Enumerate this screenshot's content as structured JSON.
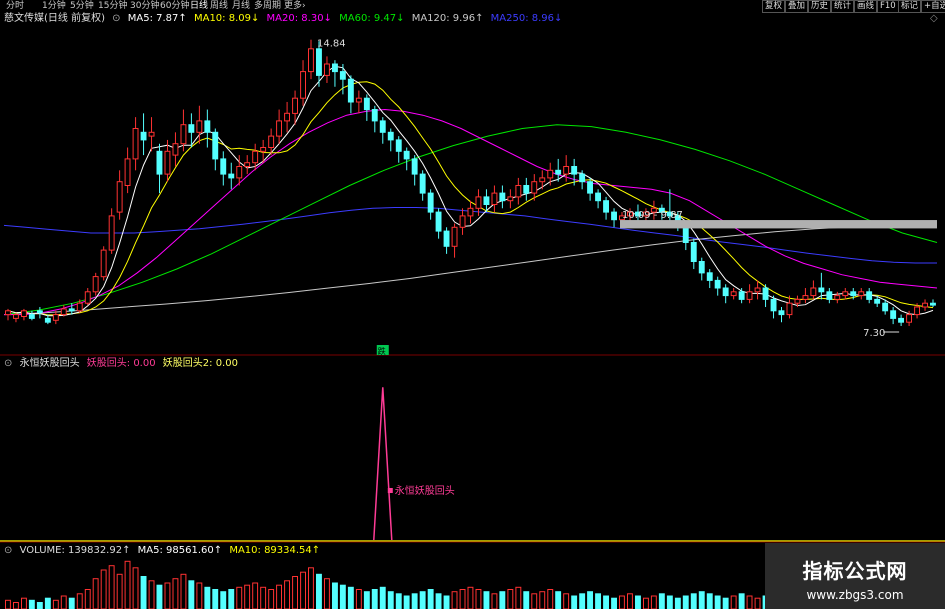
{
  "toolbar": {
    "periods": [
      "分时",
      "1分钟",
      "5分钟",
      "15分钟",
      "30分钟",
      "60分钟",
      "日线",
      "周线",
      "月线",
      "多周期",
      "更多"
    ],
    "active_period": "日线",
    "more_arrow": "›",
    "buttons": [
      "复权",
      "叠加",
      "历史",
      "统计",
      "画线",
      "F10",
      "标记",
      "+自选"
    ]
  },
  "main_legend": {
    "title": "慈文传媒(日线 前复权)",
    "ma5": "MA5: 7.87↑",
    "ma10": "MA10: 8.09↓",
    "ma20": "MA20: 8.30↓",
    "ma60": "MA60: 9.47↓",
    "ma120": "MA120: 9.96↑",
    "ma250": "MA250: 8.96↓"
  },
  "indicator_legend": {
    "title": "永恒妖股回头",
    "s1": "妖股回头: 0.00",
    "s2": "妖股回头2: 0.00"
  },
  "volume_legend": {
    "vol": "VOLUME: 139832.92↑",
    "ma5": "MA5: 98561.60↑",
    "ma10": "MA10: 89334.54↑"
  },
  "brand": {
    "name": "指标公式网",
    "url": "www.zbgs3.com"
  },
  "colors": {
    "up": "#ff3232",
    "down": "#54ffff",
    "ma5": "#ffffff",
    "ma10": "#ffff00",
    "ma20": "#ff00ff",
    "ma60": "#00e600",
    "ma120": "#c8c8c8",
    "ma250": "#3c3cff",
    "peak": "#ff3c96"
  },
  "chart_data": [
    {
      "type": "candlestick",
      "title": "慈文传媒(日线 前复权)",
      "ylim": [
        6.8,
        15.2
      ],
      "annotations": {
        "high_label": "14.84",
        "low_label": "7.30",
        "range_label": "10.09 - 9.87",
        "signal_label": "跌"
      },
      "candles": [
        [
          7.6,
          7.7,
          7.45,
          7.75
        ],
        [
          7.5,
          7.6,
          7.4,
          7.65
        ],
        [
          7.55,
          7.7,
          7.45,
          7.75
        ],
        [
          7.6,
          7.5,
          7.45,
          7.7
        ],
        [
          7.7,
          7.65,
          7.5,
          7.8
        ],
        [
          7.5,
          7.4,
          7.35,
          7.6
        ],
        [
          7.45,
          7.6,
          7.35,
          7.7
        ],
        [
          7.6,
          7.75,
          7.55,
          7.85
        ],
        [
          7.75,
          7.7,
          7.6,
          7.9
        ],
        [
          7.7,
          7.9,
          7.65,
          8.0
        ],
        [
          7.9,
          8.2,
          7.85,
          8.3
        ],
        [
          8.2,
          8.6,
          8.1,
          8.7
        ],
        [
          8.6,
          9.3,
          8.5,
          9.4
        ],
        [
          9.3,
          10.2,
          9.2,
          10.4
        ],
        [
          10.3,
          11.1,
          10.1,
          11.4
        ],
        [
          11.0,
          11.7,
          10.8,
          12.0
        ],
        [
          11.7,
          12.5,
          11.4,
          12.8
        ],
        [
          12.4,
          12.2,
          11.8,
          12.9
        ],
        [
          12.3,
          12.4,
          11.9,
          12.8
        ],
        [
          11.9,
          11.3,
          10.8,
          12.1
        ],
        [
          11.3,
          11.9,
          11.1,
          12.2
        ],
        [
          11.8,
          12.1,
          11.5,
          12.4
        ],
        [
          12.1,
          12.6,
          11.9,
          13.0
        ],
        [
          12.6,
          12.4,
          12.0,
          12.9
        ],
        [
          12.4,
          12.7,
          12.1,
          13.1
        ],
        [
          12.7,
          12.4,
          12.0,
          13.0
        ],
        [
          12.4,
          11.7,
          11.4,
          12.5
        ],
        [
          11.7,
          11.3,
          11.0,
          11.9
        ],
        [
          11.3,
          11.2,
          10.9,
          11.6
        ],
        [
          11.2,
          11.5,
          11.0,
          11.8
        ],
        [
          11.5,
          11.6,
          11.3,
          11.8
        ],
        [
          11.6,
          11.9,
          11.4,
          12.1
        ],
        [
          11.9,
          12.0,
          11.6,
          12.2
        ],
        [
          12.0,
          12.3,
          11.8,
          12.5
        ],
        [
          12.3,
          12.7,
          12.1,
          13.0
        ],
        [
          12.7,
          12.9,
          12.4,
          13.2
        ],
        [
          12.9,
          13.3,
          12.6,
          13.5
        ],
        [
          13.3,
          14.0,
          13.1,
          14.3
        ],
        [
          14.0,
          14.6,
          13.8,
          14.84
        ],
        [
          14.6,
          13.9,
          13.6,
          14.8
        ],
        [
          13.9,
          14.2,
          13.7,
          14.4
        ],
        [
          14.2,
          14.0,
          13.6,
          14.3
        ],
        [
          14.0,
          13.8,
          13.4,
          14.2
        ],
        [
          13.8,
          13.2,
          12.9,
          13.9
        ],
        [
          13.2,
          13.3,
          12.9,
          13.5
        ],
        [
          13.3,
          13.0,
          12.7,
          13.4
        ],
        [
          13.0,
          12.7,
          12.4,
          13.1
        ],
        [
          12.7,
          12.4,
          12.1,
          12.8
        ],
        [
          12.4,
          12.2,
          11.9,
          12.5
        ],
        [
          12.2,
          11.9,
          11.6,
          12.3
        ],
        [
          11.9,
          11.7,
          11.4,
          12.0
        ],
        [
          11.7,
          11.3,
          11.0,
          11.8
        ],
        [
          11.3,
          10.8,
          10.6,
          11.4
        ],
        [
          10.8,
          10.3,
          10.1,
          10.9
        ],
        [
          10.3,
          9.8,
          9.6,
          10.4
        ],
        [
          9.8,
          9.4,
          9.2,
          9.9
        ],
        [
          9.4,
          9.9,
          9.1,
          10.0
        ],
        [
          9.9,
          10.2,
          9.7,
          10.4
        ],
        [
          10.2,
          10.4,
          10.0,
          10.6
        ],
        [
          10.4,
          10.7,
          10.2,
          10.9
        ],
        [
          10.7,
          10.5,
          10.3,
          10.9
        ],
        [
          10.5,
          10.8,
          10.3,
          11.0
        ],
        [
          10.8,
          10.6,
          10.4,
          11.0
        ],
        [
          10.6,
          10.7,
          10.4,
          10.9
        ],
        [
          10.7,
          11.0,
          10.5,
          11.2
        ],
        [
          11.0,
          10.8,
          10.6,
          11.2
        ],
        [
          10.8,
          11.1,
          10.6,
          11.3
        ],
        [
          11.1,
          11.2,
          10.9,
          11.4
        ],
        [
          11.2,
          11.4,
          11.0,
          11.6
        ],
        [
          11.4,
          11.3,
          11.1,
          11.7
        ],
        [
          11.3,
          11.5,
          11.1,
          11.8
        ],
        [
          11.5,
          11.3,
          11.0,
          11.7
        ],
        [
          11.3,
          11.1,
          10.9,
          11.4
        ],
        [
          11.1,
          10.8,
          10.6,
          11.2
        ],
        [
          10.8,
          10.6,
          10.4,
          10.9
        ],
        [
          10.6,
          10.3,
          10.1,
          10.7
        ],
        [
          10.3,
          10.1,
          9.9,
          10.4
        ],
        [
          10.1,
          10.2,
          9.9,
          10.3
        ],
        [
          10.2,
          10.3,
          10.0,
          10.4
        ],
        [
          10.3,
          10.2,
          10.0,
          10.5
        ],
        [
          10.2,
          10.3,
          10.0,
          10.4
        ],
        [
          10.3,
          10.4,
          10.1,
          10.6
        ],
        [
          10.4,
          10.3,
          10.1,
          10.5
        ],
        [
          10.3,
          10.2,
          10.0,
          10.9
        ],
        [
          10.2,
          9.9,
          9.8,
          10.3
        ],
        [
          9.9,
          9.5,
          9.3,
          10.0
        ],
        [
          9.5,
          9.0,
          8.8,
          9.6
        ],
        [
          9.0,
          8.7,
          8.5,
          9.1
        ],
        [
          8.7,
          8.5,
          8.3,
          8.8
        ],
        [
          8.5,
          8.3,
          8.1,
          8.6
        ],
        [
          8.3,
          8.1,
          7.9,
          8.4
        ],
        [
          8.1,
          8.2,
          8.0,
          8.3
        ],
        [
          8.2,
          8.0,
          7.9,
          8.3
        ],
        [
          8.0,
          8.2,
          7.9,
          8.4
        ],
        [
          8.2,
          8.3,
          8.0,
          8.5
        ],
        [
          8.3,
          8.0,
          7.8,
          8.4
        ],
        [
          8.0,
          7.7,
          7.5,
          8.1
        ],
        [
          7.7,
          7.6,
          7.4,
          7.8
        ],
        [
          7.6,
          7.9,
          7.5,
          8.1
        ],
        [
          7.9,
          8.0,
          7.8,
          8.1
        ],
        [
          8.0,
          8.1,
          7.9,
          8.3
        ],
        [
          8.1,
          8.3,
          8.0,
          8.5
        ],
        [
          8.3,
          8.2,
          8.0,
          8.7
        ],
        [
          8.2,
          8.0,
          7.9,
          8.3
        ],
        [
          8.0,
          8.1,
          7.9,
          8.2
        ],
        [
          8.1,
          8.2,
          8.0,
          8.3
        ],
        [
          8.2,
          8.1,
          8.0,
          8.3
        ],
        [
          8.1,
          8.2,
          8.0,
          8.3
        ],
        [
          8.2,
          8.0,
          7.9,
          8.3
        ],
        [
          8.0,
          7.9,
          7.8,
          8.1
        ],
        [
          7.9,
          7.7,
          7.6,
          8.0
        ],
        [
          7.7,
          7.5,
          7.35,
          7.8
        ],
        [
          7.5,
          7.4,
          7.3,
          7.6
        ],
        [
          7.4,
          7.6,
          7.3,
          7.7
        ],
        [
          7.6,
          7.8,
          7.5,
          7.9
        ],
        [
          7.8,
          7.9,
          7.7,
          8.0
        ],
        [
          7.9,
          7.85,
          7.8,
          8.0
        ]
      ],
      "ma250": [
        9.95,
        9.9,
        9.85,
        9.8,
        9.75,
        9.75,
        9.75,
        9.78,
        9.82,
        9.86,
        9.92,
        9.98,
        10.05,
        10.12,
        10.2,
        10.28,
        10.35,
        10.4,
        10.42,
        10.42,
        10.4,
        10.35,
        10.3,
        10.25,
        10.2,
        10.12,
        10.05,
        9.98,
        9.9,
        9.82,
        9.75,
        9.68,
        9.6,
        9.52,
        9.45,
        9.38,
        9.3,
        9.22,
        9.15,
        9.08,
        9.02,
        8.98,
        8.96,
        8.96
      ],
      "ma120": [
        7.6,
        7.65,
        7.72,
        7.8,
        7.88,
        7.97,
        8.07,
        8.18,
        8.3,
        8.42,
        8.55,
        8.7,
        8.85,
        9.0,
        9.15,
        9.3,
        9.44,
        9.57,
        9.68,
        9.78,
        9.86,
        9.92,
        9.96,
        9.97
      ],
      "ma60": [
        7.6,
        7.72,
        7.9,
        8.15,
        8.45,
        8.8,
        9.2,
        9.65,
        10.1,
        10.55,
        11.0,
        11.4,
        11.75,
        12.05,
        12.3,
        12.5,
        12.6,
        12.55,
        12.4,
        12.2,
        11.95,
        11.65,
        11.3,
        10.9,
        10.5,
        10.1,
        9.75,
        9.5
      ],
      "ma20": [
        7.6,
        7.6,
        7.65,
        7.75,
        7.9,
        8.1,
        8.35,
        8.7,
        9.1,
        9.55,
        10.0,
        10.45,
        10.9,
        11.35,
        11.75,
        12.1,
        12.4,
        12.65,
        12.85,
        12.95,
        13.0,
        12.95,
        12.85,
        12.7,
        12.5,
        12.25,
        12.0,
        11.75,
        11.5,
        11.3,
        11.15,
        11.05,
        11.0,
        10.95,
        10.9,
        10.8,
        10.6,
        10.3,
        10.0,
        9.7,
        9.4,
        9.15,
        8.95,
        8.8,
        8.65,
        8.55,
        8.45,
        8.4,
        8.35,
        8.3
      ]
    },
    {
      "type": "line",
      "title": "永恒妖股回头",
      "series": [
        {
          "name": "妖股回头",
          "values": [
            0,
            0,
            0,
            0,
            0,
            0,
            0,
            0,
            0,
            0,
            0,
            0,
            0,
            0,
            0,
            0,
            0,
            0,
            0,
            0,
            0,
            0,
            0,
            0,
            0,
            0,
            0,
            0,
            0,
            0,
            0,
            0,
            0,
            0,
            0,
            0,
            0,
            0,
            0,
            0,
            0,
            0,
            0,
            0,
            0,
            0,
            0,
            0,
            0,
            0,
            0,
            0,
            0,
            0,
            0,
            0,
            0,
            0,
            0,
            0,
            0,
            0,
            0,
            0,
            0,
            0,
            0,
            0,
            0,
            0,
            0,
            0,
            0,
            0,
            0,
            0,
            0,
            0,
            0,
            0,
            0,
            0,
            0,
            0,
            0,
            0,
            0,
            0,
            0,
            0,
            0,
            0,
            0,
            0,
            0,
            0,
            0,
            0,
            0,
            0,
            0,
            0,
            0,
            0,
            0,
            0,
            0,
            0,
            0,
            0,
            0,
            0,
            0,
            0,
            0,
            0,
            0,
            0,
            0,
            0,
            0,
            0
          ]
        },
        {
          "name": "妖股回头2",
          "values": [
            0
          ]
        }
      ],
      "peak": {
        "index": 47,
        "value": 1.0,
        "label": "永恒妖股回头"
      },
      "ylim": [
        0,
        1.1
      ]
    },
    {
      "type": "bar",
      "title": "VOLUME",
      "values": [
        4,
        3,
        5,
        4,
        3,
        5,
        4,
        6,
        5,
        7,
        9,
        14,
        18,
        20,
        16,
        22,
        19,
        15,
        13,
        11,
        12,
        14,
        16,
        13,
        12,
        10,
        9,
        8,
        9,
        10,
        11,
        12,
        10,
        9,
        11,
        13,
        15,
        17,
        19,
        16,
        14,
        12,
        11,
        10,
        9,
        8,
        9,
        10,
        8,
        7,
        6,
        7,
        8,
        9,
        7,
        6,
        8,
        9,
        10,
        9,
        8,
        7,
        8,
        9,
        10,
        8,
        7,
        8,
        9,
        8,
        7,
        6,
        7,
        8,
        7,
        6,
        5,
        6,
        7,
        6,
        5,
        6,
        7,
        6,
        5,
        6,
        7,
        8,
        7,
        6,
        5,
        6,
        7,
        6,
        5,
        6,
        7,
        6,
        5,
        6,
        5,
        4,
        5,
        6,
        5,
        4,
        5,
        4,
        5,
        4,
        5,
        4,
        3,
        4,
        5,
        4,
        5,
        6,
        5,
        6
      ],
      "ylim": [
        0,
        24
      ]
    }
  ]
}
